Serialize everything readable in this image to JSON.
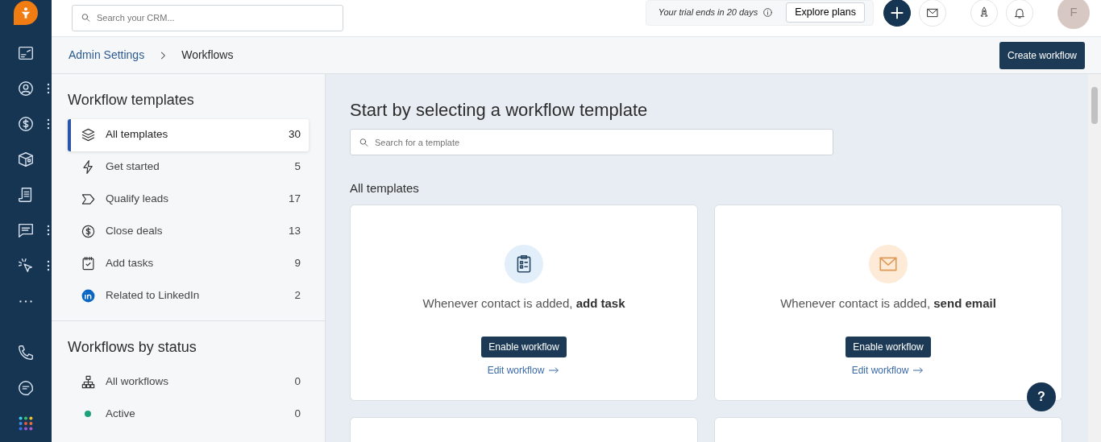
{
  "rail": [
    {
      "menu": false
    },
    {
      "menu": true
    },
    {
      "menu": true
    },
    {
      "menu": false
    },
    {
      "menu": false
    },
    {
      "menu": true
    },
    {
      "menu": true
    },
    {
      "menu": false
    }
  ],
  "search": {
    "placeholder": "Search your CRM..."
  },
  "trial": {
    "text": "Your trial ends in 20 days",
    "button": "Explore plans"
  },
  "avatar": {
    "initial": "F"
  },
  "breadcrumb": [
    {
      "label": "Admin Settings",
      "link": true
    },
    {
      "label": "Workflows",
      "link": false
    }
  ],
  "create_button": "Create workflow",
  "template_panel": {
    "title": "Workflow templates",
    "items": [
      {
        "label": "All templates",
        "count": "30",
        "selected": true
      },
      {
        "label": "Get started",
        "count": "5",
        "selected": false
      },
      {
        "label": "Qualify leads",
        "count": "17",
        "selected": false
      },
      {
        "label": "Close deals",
        "count": "13",
        "selected": false
      },
      {
        "label": "Add tasks",
        "count": "9",
        "selected": false
      },
      {
        "label": "Related to LinkedIn",
        "count": "2",
        "selected": false
      }
    ]
  },
  "status_panel": {
    "title": "Workflows by status",
    "items": [
      {
        "kind": "icon",
        "label": "All workflows",
        "count": "0",
        "selected": false
      },
      {
        "kind": "dot",
        "color": "#1aa37a",
        "label": "Active",
        "count": "0",
        "selected": false
      }
    ]
  },
  "main": {
    "title": "Start by selecting a workflow template",
    "search_placeholder": "Search for a template",
    "section": "All templates",
    "cards": [
      {
        "kind": "template",
        "text": "Whenever contact is added, **add task**",
        "button": "Enable workflow",
        "link": "Edit workflow"
      },
      {
        "kind": "template",
        "text": "Whenever contact is added, **send email**",
        "button": "Enable workflow",
        "link": "Edit workflow"
      },
      {
        "kind": "blank"
      },
      {
        "kind": "blank"
      }
    ]
  },
  "help_button": "?"
}
